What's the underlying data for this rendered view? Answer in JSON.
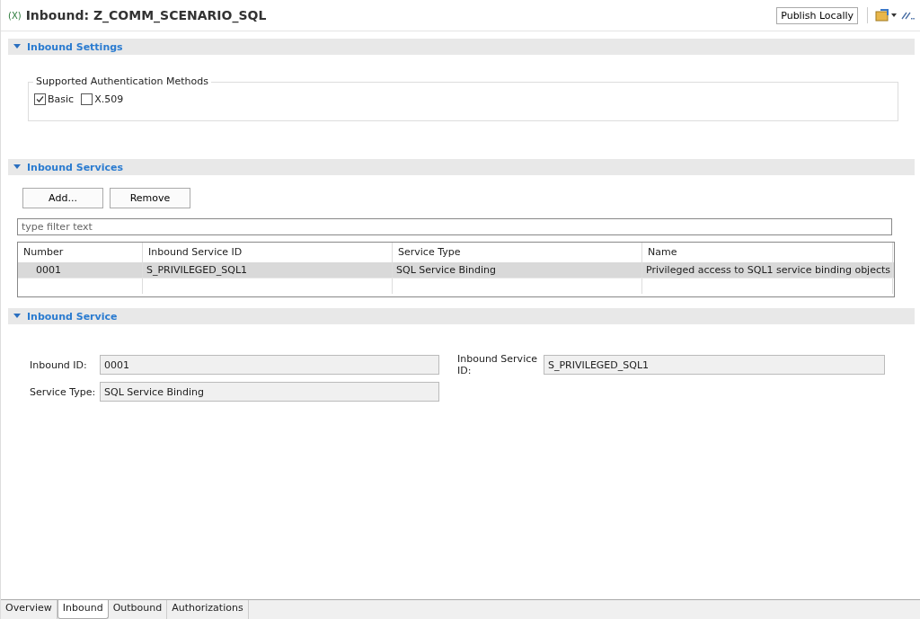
{
  "header": {
    "icon_text": "(X)",
    "title": "Inbound: Z_COMM_SCENARIO_SQL",
    "publish_button": "Publish Locally"
  },
  "inbound_settings": {
    "title": "Inbound Settings",
    "expanded": true,
    "group_title": "Supported Authentication Methods",
    "methods": [
      {
        "label": "Basic",
        "checked": true
      },
      {
        "label": "X.509",
        "checked": false
      }
    ]
  },
  "inbound_services": {
    "title": "Inbound Services",
    "expanded": true,
    "buttons": [
      "Add...",
      "Remove"
    ],
    "filter": {
      "placeholder": "type filter text"
    },
    "table": {
      "columns": [
        "Number",
        "Inbound Service ID",
        "Service Type",
        "Name"
      ],
      "rows": [
        {
          "cells": [
            "0001",
            "S_PRIVILEGED_SQL1",
            "SQL Service Binding",
            "Privileged access to SQL1 service binding objects"
          ],
          "selected": true
        }
      ]
    }
  },
  "inbound_service": {
    "title": "Inbound Service",
    "expanded": true,
    "fields": [
      {
        "label": "Inbound ID:",
        "value": "0001"
      },
      {
        "label": "Inbound Service ID:",
        "value": "S_PRIVILEGED_SQL1"
      },
      {
        "label": "Service Type:",
        "value": "SQL Service Binding"
      }
    ]
  },
  "tabs": [
    {
      "label": "Overview",
      "selected": false
    },
    {
      "label": "Inbound",
      "selected": true
    },
    {
      "label": "Outbound",
      "selected": false
    },
    {
      "label": "Authorizations",
      "selected": false
    }
  ]
}
